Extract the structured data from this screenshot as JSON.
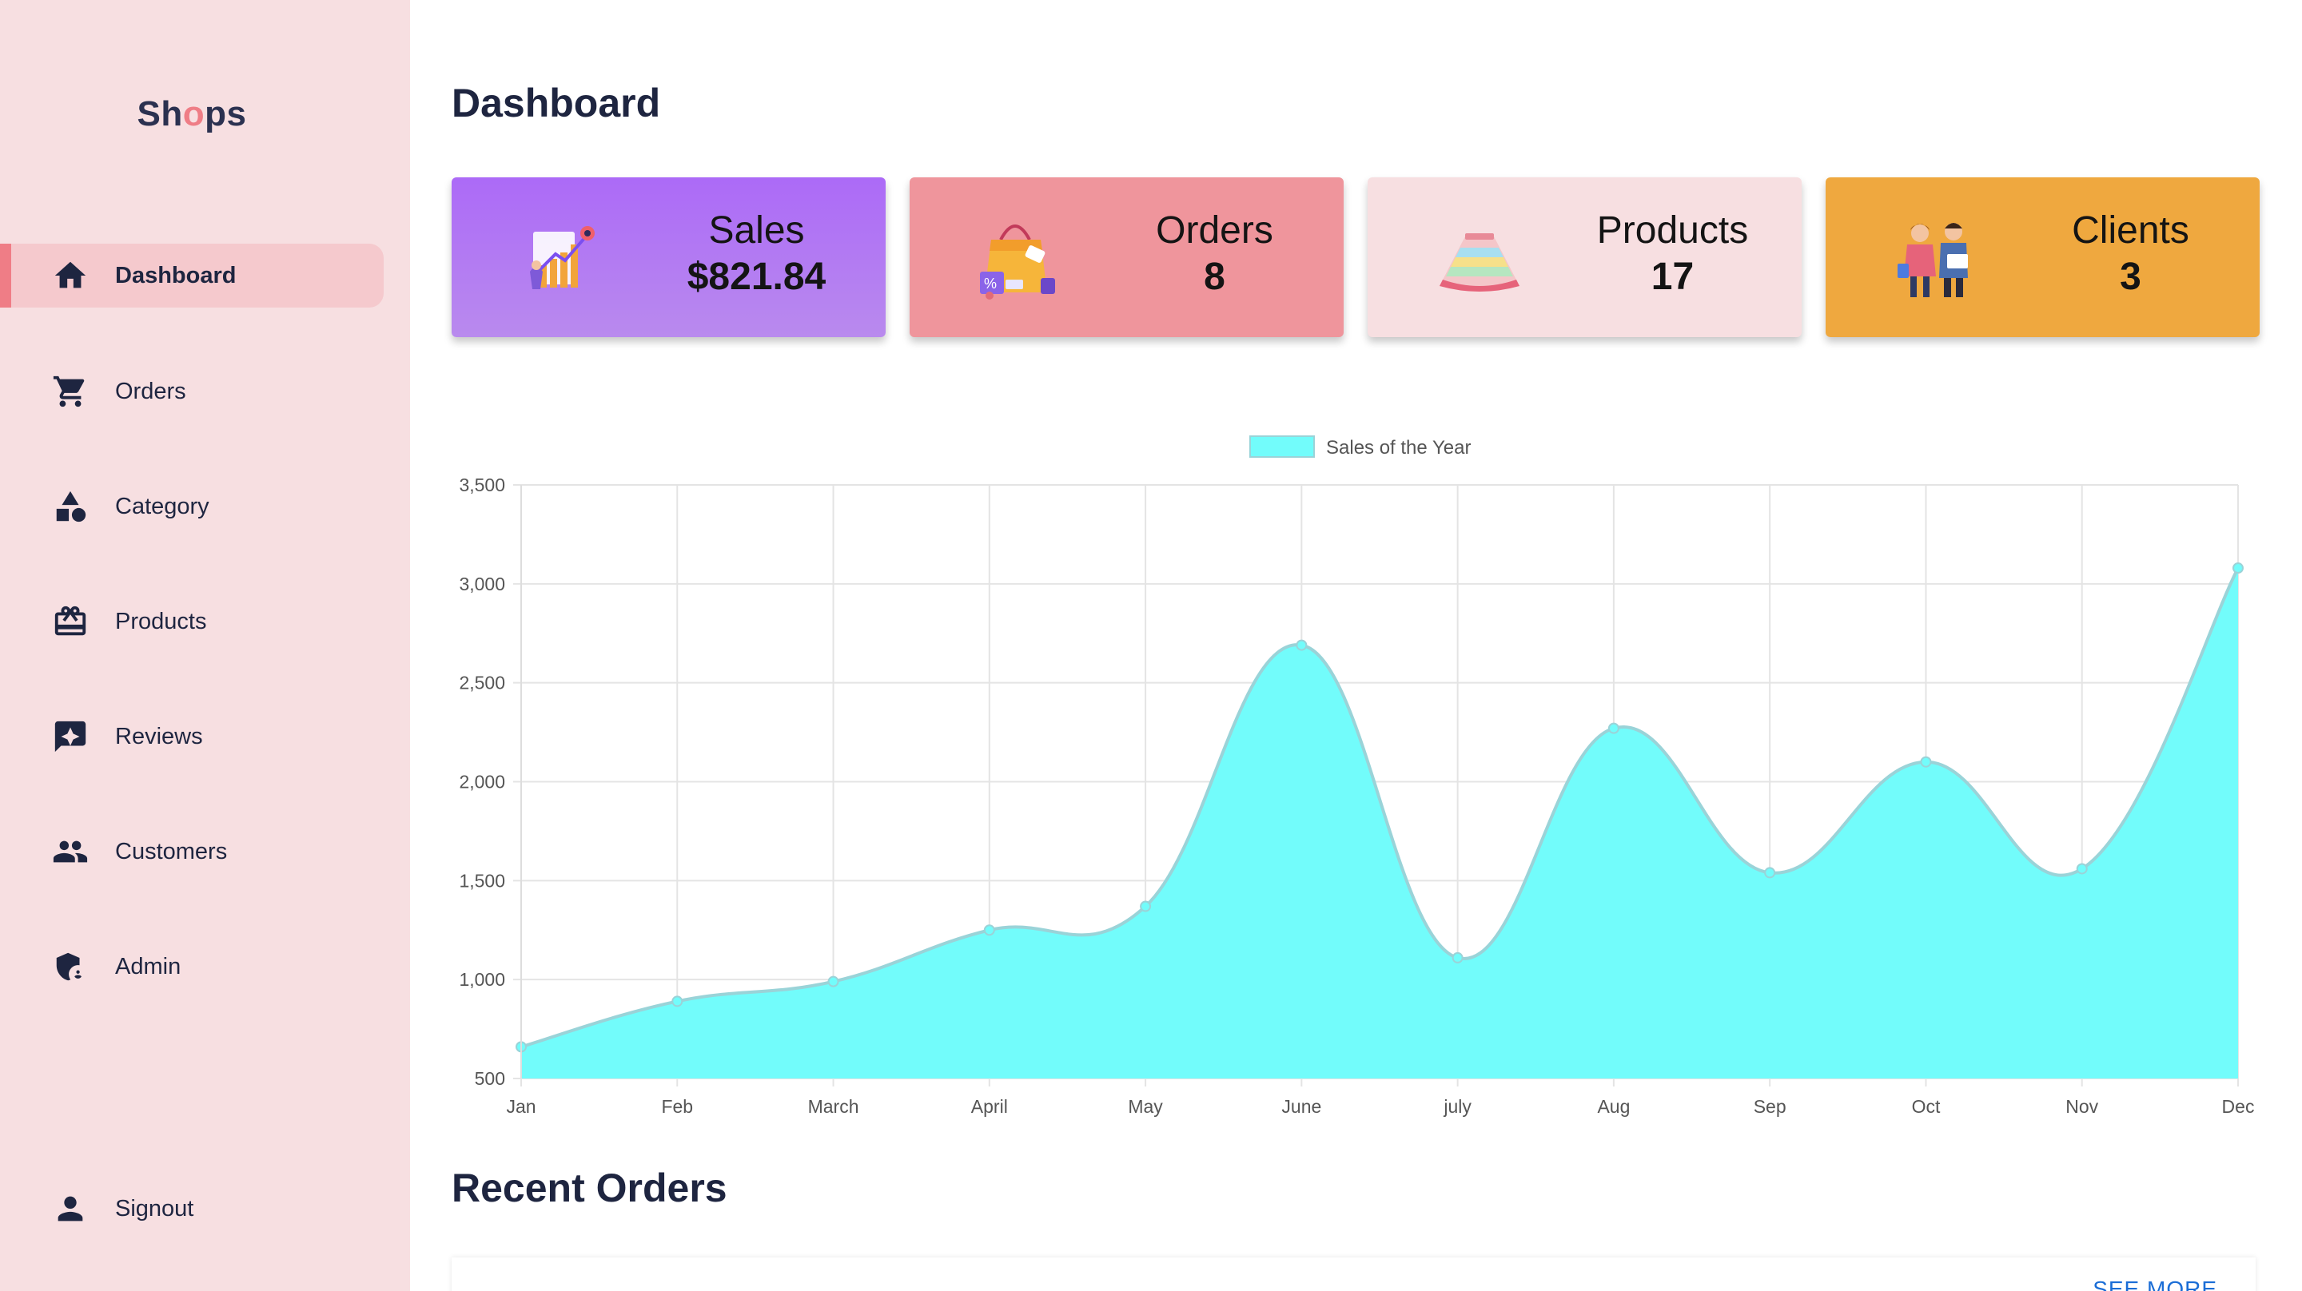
{
  "sidebar": {
    "logo": {
      "part1": "Sh",
      "part2": "o",
      "part3": "ps"
    },
    "items": [
      {
        "label": "Dashboard",
        "icon": "home-icon",
        "active": true
      },
      {
        "label": "Orders",
        "icon": "cart-icon"
      },
      {
        "label": "Category",
        "icon": "category-icon"
      },
      {
        "label": "Products",
        "icon": "products-icon"
      },
      {
        "label": "Reviews",
        "icon": "reviews-icon"
      },
      {
        "label": "Customers",
        "icon": "customers-icon"
      },
      {
        "label": "Admin",
        "icon": "admin-shield-icon"
      }
    ],
    "signout": {
      "label": "Signout",
      "icon": "person-icon"
    },
    "colors": {
      "background": "#f7dfe1",
      "active_bg": "#f5c9cd",
      "accent": "#ef7d86"
    }
  },
  "main": {
    "title": "Dashboard",
    "cards": [
      {
        "title": "Sales",
        "value": "$821.84",
        "illustration": "sales-rocket-illustration",
        "color": "#ad6cf7"
      },
      {
        "title": "Orders",
        "value": "8",
        "illustration": "shopping-bag-illustration",
        "color": "#ef959c"
      },
      {
        "title": "Products",
        "value": "17",
        "illustration": "skirt-illustration",
        "color": "#f7dfe1"
      },
      {
        "title": "Clients",
        "value": "3",
        "illustration": "clients-illustration",
        "color": "#efa83f"
      }
    ],
    "recent_orders": {
      "title": "Recent Orders",
      "see_more": "SEE MORE"
    }
  },
  "chart_data": {
    "type": "area",
    "x": [
      "Jan",
      "Feb",
      "March",
      "April",
      "May",
      "June",
      "july",
      "Aug",
      "Sep",
      "Oct",
      "Nov",
      "Dec"
    ],
    "series": [
      {
        "name": "Sales of the Year",
        "values": [
          660,
          890,
          990,
          1250,
          1370,
          2690,
          1110,
          2270,
          1540,
          2100,
          1560,
          3080
        ],
        "color": "#72fcfb"
      }
    ],
    "ylim": [
      500,
      3500
    ],
    "yticks": [
      "500",
      "1,000",
      "1,500",
      "2,000",
      "2,500",
      "3,000",
      "3,500"
    ],
    "grid": true,
    "legend": "top-center"
  }
}
